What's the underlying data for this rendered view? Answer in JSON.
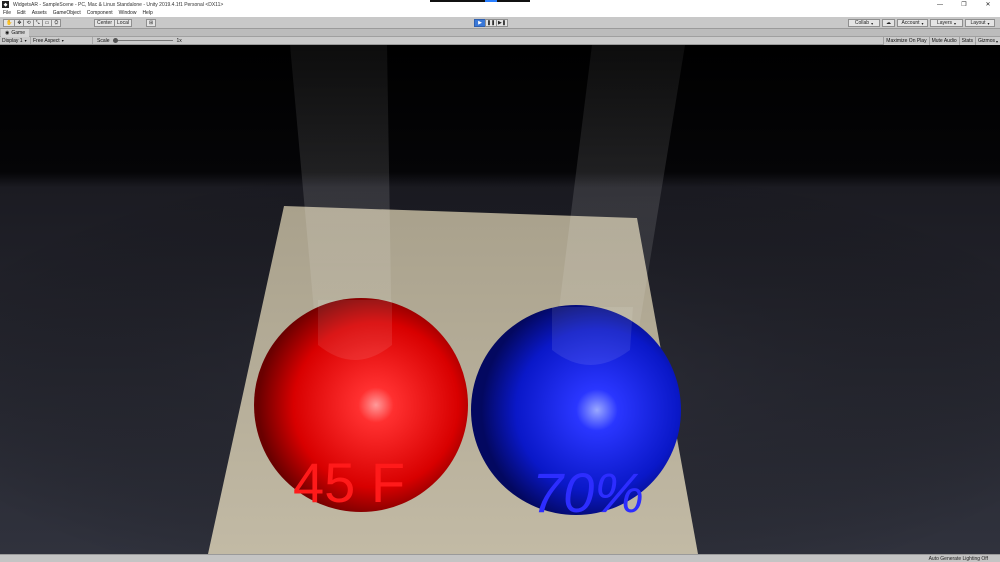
{
  "window": {
    "title": "WidgetsAR - SampleScene - PC, Mac & Linux Standalone - Unity 2019.4.1f1 Personal <DX11>",
    "controls": {
      "minimize": "—",
      "maximize": "❐",
      "close": "✕"
    }
  },
  "menu": [
    "File",
    "Edit",
    "Assets",
    "GameObject",
    "Component",
    "Window",
    "Help"
  ],
  "toolbar": {
    "tools": [
      "✋",
      "✥",
      "⟲",
      "⤡",
      "▭",
      "⛭"
    ],
    "pivot": "Center",
    "space": "Local",
    "snap_icon": "⊞",
    "play": "▶",
    "pause": "❚❚",
    "step": "▶❚",
    "collab": "Collab",
    "cloud": "☁",
    "account": "Account",
    "layers": "Layers",
    "layout": "Layout"
  },
  "game_tab": {
    "icon": "◉",
    "label": "Game"
  },
  "game_controls": {
    "display": "Display 1",
    "aspect": "Free Aspect",
    "scale_label": "Scale",
    "scale_value": "1x",
    "scale_fraction": 0,
    "maximize_on_play": "Maximize On Play",
    "mute_audio": "Mute Audio",
    "stats": "Stats",
    "gizmos": "Gizmos"
  },
  "scene": {
    "left_sphere_label": "45 F",
    "right_sphere_label": "70%",
    "colors": {
      "red_sphere": "#ff2020",
      "blue_sphere": "#1a1aff",
      "left_text": "#ff1a1a",
      "right_text": "#2d2dff",
      "table": "#b2aa96"
    }
  },
  "status": {
    "message": "Auto Generate Lighting Off"
  }
}
